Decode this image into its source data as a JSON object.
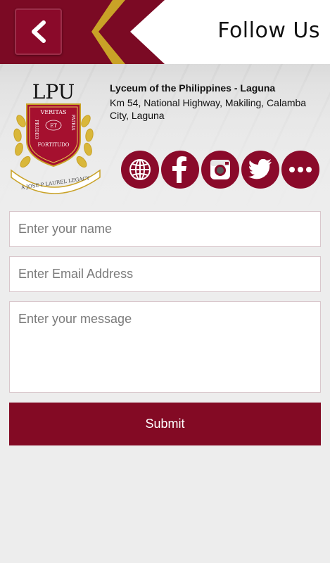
{
  "header": {
    "title": "Follow Us",
    "back_icon": "chevron-left-icon"
  },
  "college": {
    "logo_text": "LPU",
    "logo_motto": [
      "VERITAS",
      "ET",
      "PATRIA",
      "PRUDEO",
      "FORTITUDO"
    ],
    "logo_banner": "A JOSE P LAUREL LEGACY",
    "name": "Lyceum of the Philippines - Laguna",
    "address": "Km 54, National Highway, Makiling, Calamba City, Laguna"
  },
  "social": [
    {
      "name": "globe-icon"
    },
    {
      "name": "facebook-icon"
    },
    {
      "name": "instagram-icon"
    },
    {
      "name": "twitter-icon"
    },
    {
      "name": "more-icon"
    }
  ],
  "form": {
    "name_placeholder": "Enter your name",
    "email_placeholder": "Enter Email Address",
    "message_placeholder": "Enter your message",
    "submit_label": "Submit"
  },
  "colors": {
    "accent": "#8a0a2a",
    "gold": "#c9a227",
    "background": "#ededed"
  }
}
